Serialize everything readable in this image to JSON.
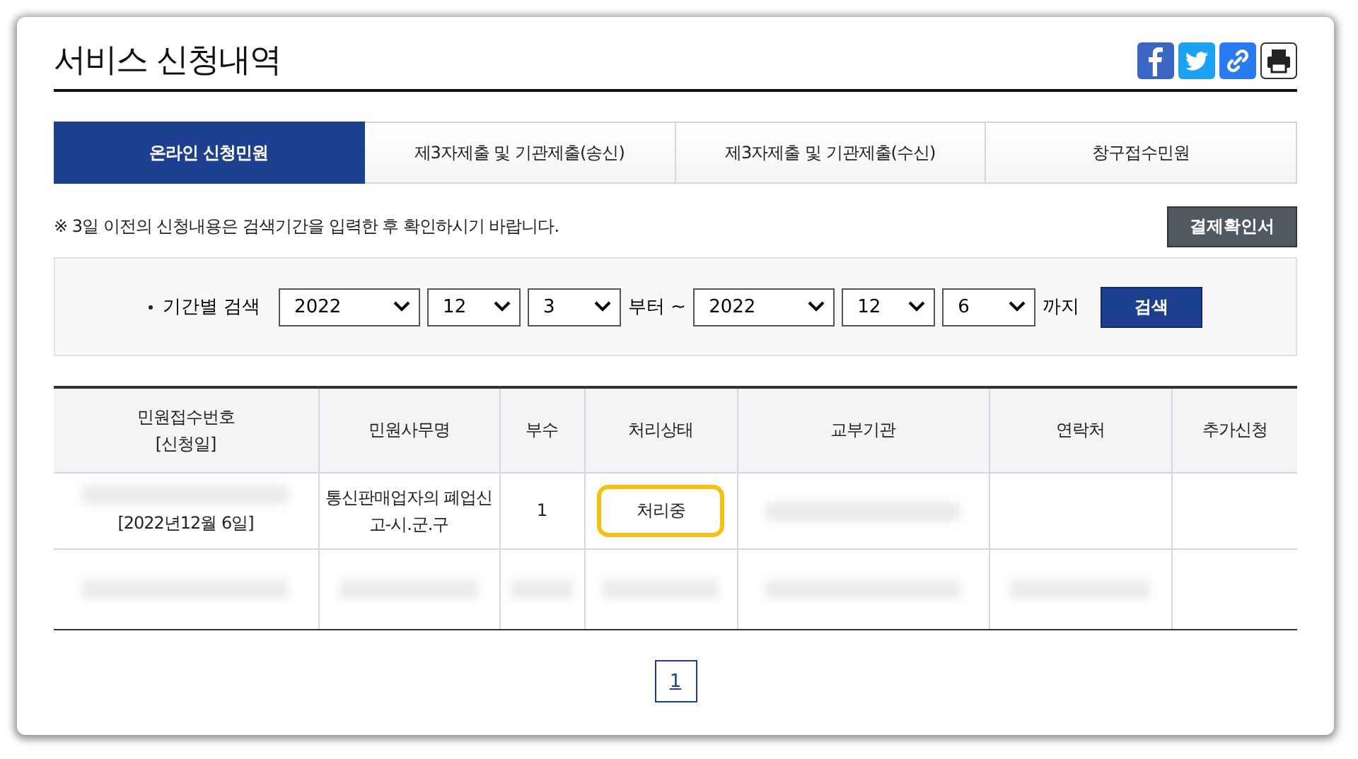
{
  "page": {
    "title": "서비스 신청내역"
  },
  "tabs": [
    {
      "label": "온라인 신청민원",
      "selected": true
    },
    {
      "label": "제3자제출 및 기관제출(송신)",
      "selected": false
    },
    {
      "label": "제3자제출 및 기관제출(수신)",
      "selected": false
    },
    {
      "label": "창구접수민원",
      "selected": false
    }
  ],
  "notice": "※ 3일 이전의 신청내용은 검색기간을 입력한 후 확인하시기 바랍니다.",
  "receipt_button": "결제확인서",
  "search": {
    "label": "기간별 검색",
    "from": [
      "2022",
      "12",
      "3"
    ],
    "from_suffix": "부터 ~",
    "to": [
      "2022",
      "12",
      "6"
    ],
    "to_suffix": "까지",
    "button": "검색"
  },
  "table": {
    "columns": [
      "민원접수번호\n[신청일]",
      "민원사무명",
      "부수",
      "처리상태",
      "교부기관",
      "연락처",
      "추가신청"
    ],
    "rows": [
      {
        "cells": [
          {
            "text": "[2022년12월 6일]",
            "redacted": true
          },
          {
            "text": "통신판매업자의 폐업신고-시.군.구"
          },
          {
            "text": "1"
          },
          {
            "text": "처리중",
            "highlighted": true
          },
          {
            "redacted": true
          },
          {},
          {}
        ]
      },
      {
        "cells": [
          {
            "redacted": true
          },
          {
            "redacted": true
          },
          {
            "redacted": true
          },
          {
            "redacted": true
          },
          {
            "redacted": true
          },
          {
            "redacted": true
          },
          {}
        ]
      }
    ]
  },
  "pagination": [
    {
      "label": "1",
      "selected": true
    }
  ]
}
